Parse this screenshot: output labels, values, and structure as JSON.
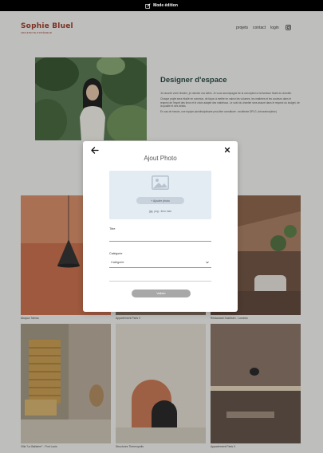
{
  "edit_bar": {
    "label": "Mode édition",
    "icon": "pen-icon",
    "color": "#000000"
  },
  "header": {
    "brand_name": "Sophie Bluel",
    "brand_tagline": "ARCHITECTE D'INTÉRIEUR",
    "brand_color": "#9b3421",
    "nav": [
      "projets",
      "contact",
      "login"
    ],
    "social_icon": "instagram-icon"
  },
  "about": {
    "title": "Designer d'espace",
    "paragraphs": [
      "Je raconte votre histoire, je valorise vos idées. Je vous accompagne de la conception à la livraison finale du chantier.",
      "Chaque projet sera étudié en commun, de façon à mettre en valeur les volumes, les matières et les couleurs dans le respect de l'esprit des lieux et le choix adapté des matériaux. Le suivi du chantier sera assuré dans le respect du budget, de la qualité et des délais.",
      "En cas de besoin, une équipe pluridisciplinaire peut-être constituée : architecte DPLG, décorateur(trice)"
    ]
  },
  "gallery": {
    "captions": [
      "Abajour Tahina",
      "Appartement Paris V",
      "Restaurant Sushisen - Londres",
      "Villa \"La Balisiere\" - Port Louis",
      "Structures Thermopolis",
      "Appartement Paris X"
    ]
  },
  "modal": {
    "title": "Ajout Photo",
    "back_icon": "arrow-left-icon",
    "close_icon": "close-icon",
    "upload_icon": "image-icon",
    "add_photo_label": "+ Ajouter photo",
    "upload_hint": "jpg, png : 4mo max",
    "title_field_label": "Titre",
    "title_field_value": "",
    "category_label": "Catégorie",
    "category_value": "Catégorie",
    "validate_label": "Valider",
    "upload_bg": "#e3ebf3",
    "validate_color": "#a8a8a8"
  }
}
